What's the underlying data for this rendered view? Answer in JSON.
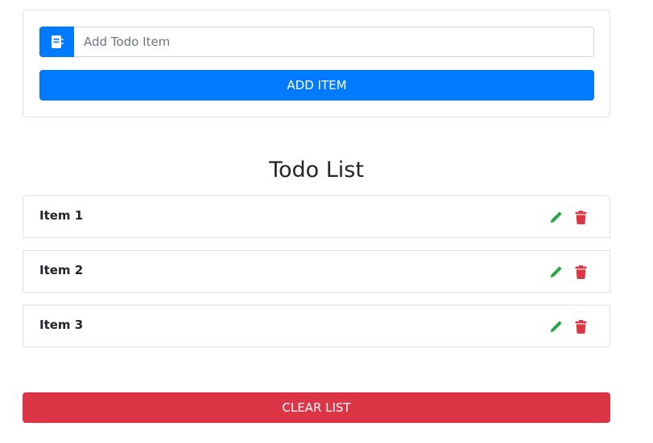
{
  "form": {
    "input_placeholder": "Add Todo Item",
    "input_value": "",
    "input_icon": "book-icon",
    "add_button_label": "ADD ITEM"
  },
  "list": {
    "title": "Todo List",
    "items": [
      {
        "label": "Item 1",
        "edit_icon": "pencil-icon",
        "delete_icon": "trash-icon"
      },
      {
        "label": "Item 2",
        "edit_icon": "pencil-icon",
        "delete_icon": "trash-icon"
      },
      {
        "label": "Item 3",
        "edit_icon": "pencil-icon",
        "delete_icon": "trash-icon"
      }
    ]
  },
  "clear_button_label": "CLEAR LIST",
  "colors": {
    "primary": "#007bff",
    "danger": "#dc3545",
    "success": "#28a745",
    "border": "#dee2e6"
  }
}
